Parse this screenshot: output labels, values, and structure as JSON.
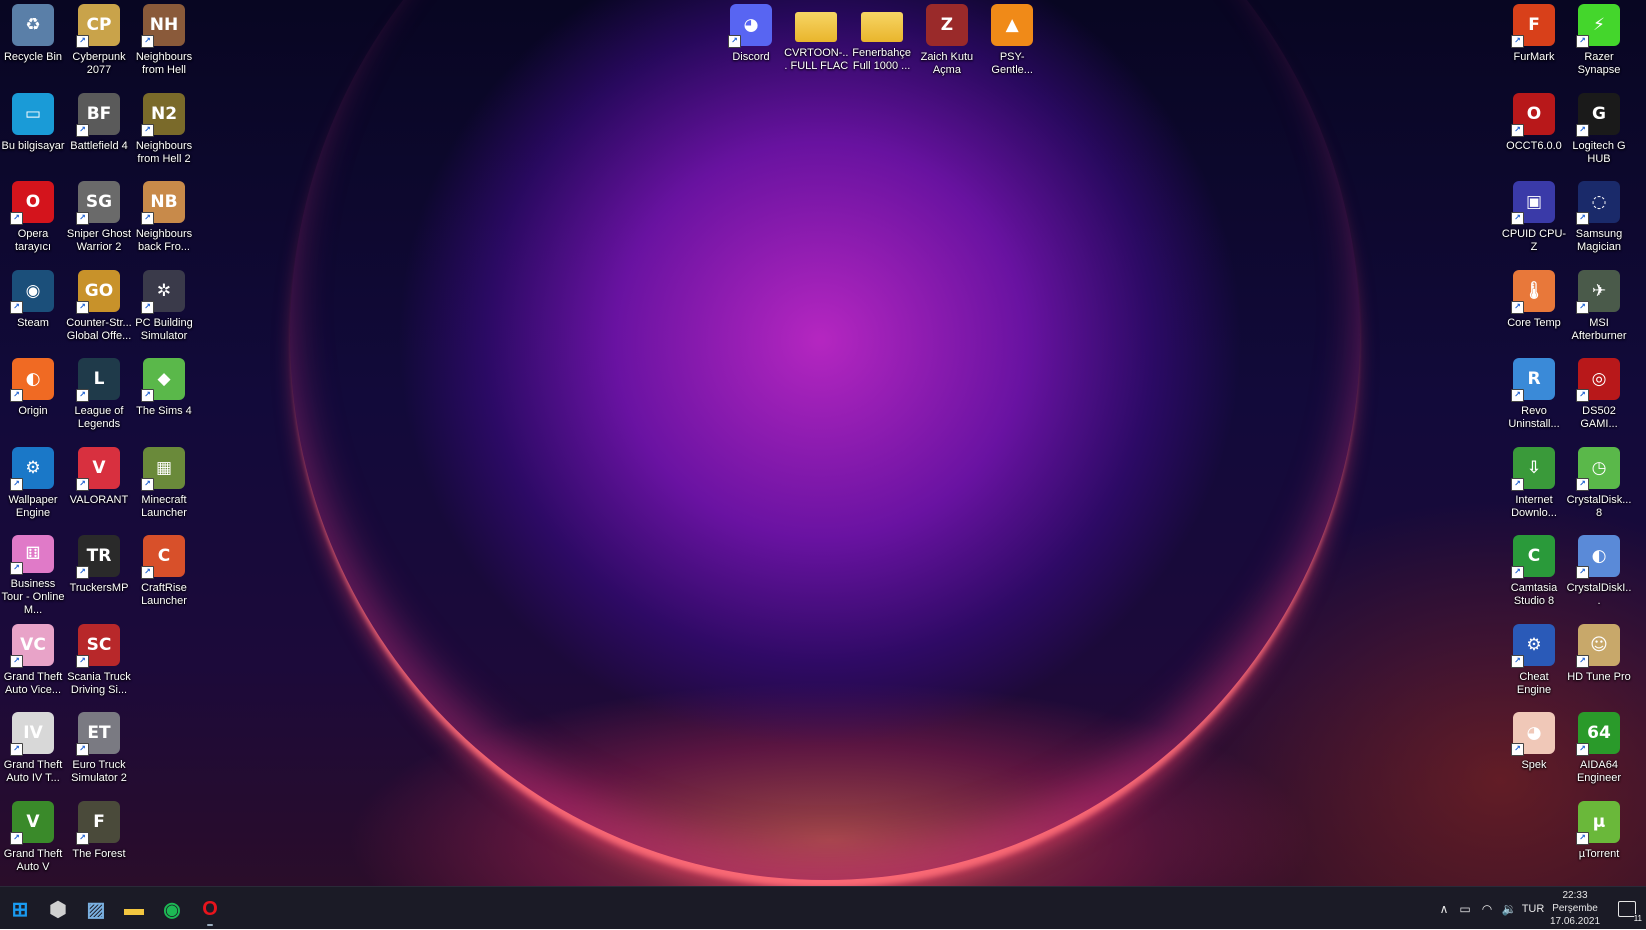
{
  "desktop_icons": {
    "col1": [
      {
        "label": "Recycle Bin",
        "icon": "recycle-bin-icon",
        "color": "#5a7fa8",
        "glyph": "♻",
        "shortcut": false
      },
      {
        "label": "Bu bilgisayar",
        "icon": "monitor-icon",
        "color": "#1a9bd7",
        "glyph": "▭",
        "shortcut": false
      },
      {
        "label": "Opera tarayıcı",
        "icon": "opera-icon",
        "color": "#d4141c",
        "glyph": "O",
        "shortcut": true
      },
      {
        "label": "Steam",
        "icon": "steam-icon",
        "color": "#1b4f7a",
        "glyph": "◉",
        "shortcut": true
      },
      {
        "label": "Origin",
        "icon": "origin-icon",
        "color": "#f06a23",
        "glyph": "◐",
        "shortcut": true
      },
      {
        "label": "Wallpaper Engine",
        "icon": "wallpaper-engine-icon",
        "color": "#1a78c8",
        "glyph": "⚙",
        "shortcut": true
      },
      {
        "label": "Business Tour - Online M...",
        "icon": "dice-icon",
        "color": "#e07ac8",
        "glyph": "⚅",
        "shortcut": true
      },
      {
        "label": "Grand Theft Auto Vice...",
        "icon": "gta-vice-city-icon",
        "color": "#e8a3c8",
        "glyph": "VC",
        "shortcut": true
      },
      {
        "label": "Grand Theft Auto IV T...",
        "icon": "gta-iv-icon",
        "color": "#d8d8d8",
        "glyph": "IV",
        "shortcut": true
      },
      {
        "label": "Grand Theft Auto V",
        "icon": "gta-v-icon",
        "color": "#3a8a2a",
        "glyph": "V",
        "shortcut": true
      }
    ],
    "col2": [
      {
        "label": "Cyberpunk 2077",
        "icon": "cyberpunk-icon",
        "color": "#c9a34a",
        "glyph": "CP",
        "shortcut": true
      },
      {
        "label": "Battlefield 4",
        "icon": "battlefield-icon",
        "color": "#5a5a5a",
        "glyph": "BF",
        "shortcut": true
      },
      {
        "label": "Sniper Ghost Warrior 2",
        "icon": "sniper-icon",
        "color": "#6a6a6a",
        "glyph": "SG",
        "shortcut": true
      },
      {
        "label": "Counter-Str... Global Offe...",
        "icon": "csgo-icon",
        "color": "#c8922a",
        "glyph": "GO",
        "shortcut": true
      },
      {
        "label": "League of Legends",
        "icon": "league-icon",
        "color": "#1f3a4a",
        "glyph": "L",
        "shortcut": true
      },
      {
        "label": "VALORANT",
        "icon": "valorant-icon",
        "color": "#d8303f",
        "glyph": "V",
        "shortcut": true
      },
      {
        "label": "TruckersMP",
        "icon": "truck-icon",
        "color": "#2a2a2a",
        "glyph": "TR",
        "shortcut": true
      },
      {
        "label": "Scania Truck Driving Si...",
        "icon": "scania-truck-icon",
        "color": "#b8282a",
        "glyph": "SC",
        "shortcut": true
      },
      {
        "label": "Euro Truck Simulator 2",
        "icon": "euro-truck-icon",
        "color": "#7a7a82",
        "glyph": "ET",
        "shortcut": true
      },
      {
        "label": "The Forest",
        "icon": "forest-icon",
        "color": "#4a4a3a",
        "glyph": "F",
        "shortcut": true
      }
    ],
    "col3": [
      {
        "label": "Neighbours from Hell",
        "icon": "neighbours-icon",
        "color": "#8a5a3a",
        "glyph": "NH",
        "shortcut": true
      },
      {
        "label": "Neighbours from Hell 2",
        "icon": "neighbours2-icon",
        "color": "#7a6a2a",
        "glyph": "N2",
        "shortcut": true
      },
      {
        "label": "Neighbours back Fro...",
        "icon": "neighbours-back-icon",
        "color": "#c88a4a",
        "glyph": "NB",
        "shortcut": true
      },
      {
        "label": "PC Building Simulator",
        "icon": "fan-icon",
        "color": "#3a3a4a",
        "glyph": "✲",
        "shortcut": true
      },
      {
        "label": "The Sims 4",
        "icon": "sims-icon",
        "color": "#5ab84a",
        "glyph": "◆",
        "shortcut": true
      },
      {
        "label": "Minecraft Launcher",
        "icon": "minecraft-icon",
        "color": "#6a8a3a",
        "glyph": "▦",
        "shortcut": true
      },
      {
        "label": "CraftRise Launcher",
        "icon": "craftrise-icon",
        "color": "#d8502a",
        "glyph": "C",
        "shortcut": true
      }
    ],
    "top": [
      {
        "label": "Discord",
        "icon": "discord-icon",
        "color": "#5865f2",
        "glyph": "◕",
        "shortcut": true
      },
      {
        "label": "CVRTOON-... FULL FLAC",
        "icon": "folder-icon",
        "color": "#f2c640",
        "glyph": "",
        "shortcut": false
      },
      {
        "label": "Fenerbahçe Full 1000 ...",
        "icon": "folder-icon",
        "color": "#f2c640",
        "glyph": "",
        "shortcut": false
      },
      {
        "label": "Zaich Kutu Açma",
        "icon": "zaich-icon",
        "color": "#9a2a2a",
        "glyph": "Z",
        "shortcut": false
      },
      {
        "label": "PSY-Gentle...",
        "icon": "vlc-icon",
        "color": "#f08a18",
        "glyph": "▲",
        "shortcut": false
      }
    ],
    "right1": [
      {
        "label": "FurMark",
        "icon": "furmark-icon",
        "color": "#d8401a",
        "glyph": "F",
        "shortcut": true
      },
      {
        "label": "OCCT6.0.0",
        "icon": "occt-icon",
        "color": "#b8181a",
        "glyph": "O",
        "shortcut": true
      },
      {
        "label": "CPUID CPU-Z",
        "icon": "cpu-icon",
        "color": "#3a3aa8",
        "glyph": "▣",
        "shortcut": true
      },
      {
        "label": "Core Temp",
        "icon": "thermometer-icon",
        "color": "#e8783a",
        "glyph": "🌡",
        "shortcut": true
      },
      {
        "label": "Revo Uninstall...",
        "icon": "revo-icon",
        "color": "#3a8ad8",
        "glyph": "R",
        "shortcut": true
      },
      {
        "label": "Internet Downlo...",
        "icon": "idm-icon",
        "color": "#3a9a3a",
        "glyph": "⇩",
        "shortcut": true
      },
      {
        "label": "Camtasia Studio 8",
        "icon": "camtasia-icon",
        "color": "#2a9a3a",
        "glyph": "C",
        "shortcut": true
      },
      {
        "label": "Cheat Engine",
        "icon": "cheat-engine-icon",
        "color": "#2a5ab8",
        "glyph": "⚙",
        "shortcut": true
      },
      {
        "label": "Spek",
        "icon": "spek-icon",
        "color": "#f0c8b8",
        "glyph": "◕",
        "shortcut": true
      }
    ],
    "right2": [
      {
        "label": "Razer Synapse",
        "icon": "razer-icon",
        "color": "#44d62c",
        "glyph": "⚡",
        "shortcut": true
      },
      {
        "label": "Logitech G HUB",
        "icon": "logitech-icon",
        "color": "#1a1a1a",
        "glyph": "G",
        "shortcut": true
      },
      {
        "label": "Samsung Magician",
        "icon": "samsung-magician-icon",
        "color": "#1a2a6a",
        "glyph": "◌",
        "shortcut": true
      },
      {
        "label": "MSI Afterburner",
        "icon": "msi-icon",
        "color": "#4a5a4a",
        "glyph": "✈",
        "shortcut": true
      },
      {
        "label": "DS502 GAMI...",
        "icon": "headset-icon",
        "color": "#b8181a",
        "glyph": "◎",
        "shortcut": true
      },
      {
        "label": "CrystalDisk... 8",
        "icon": "crystaldisk-icon",
        "color": "#5ab84a",
        "glyph": "◷",
        "shortcut": true
      },
      {
        "label": "CrystalDiskI...",
        "icon": "crystaldiskinfo-icon",
        "color": "#5a8ad8",
        "glyph": "◐",
        "shortcut": true
      },
      {
        "label": "HD Tune Pro",
        "icon": "hdtune-icon",
        "color": "#c8a86a",
        "glyph": "☺",
        "shortcut": true
      },
      {
        "label": "AIDA64 Engineer",
        "icon": "aida64-icon",
        "color": "#2a9a2a",
        "glyph": "64",
        "shortcut": true
      },
      {
        "label": "µTorrent",
        "icon": "utorrent-icon",
        "color": "#6ab83a",
        "glyph": "µ",
        "shortcut": true
      }
    ]
  },
  "taskbar": {
    "apps": [
      {
        "name": "start-button",
        "icon": "windows-icon",
        "glyph": "⊞",
        "color": "#1a9bf0"
      },
      {
        "name": "taskbar-app-hex",
        "icon": "hexagon-icon",
        "glyph": "⬢",
        "color": "#d0d0d0"
      },
      {
        "name": "taskbar-app-photos",
        "icon": "photos-icon",
        "glyph": "▨",
        "color": "#7ab0e0"
      },
      {
        "name": "taskbar-app-explorer",
        "icon": "folder-icon",
        "glyph": "▬",
        "color": "#f2c640"
      },
      {
        "name": "taskbar-app-spotify",
        "icon": "spotify-icon",
        "glyph": "◉",
        "color": "#1db954"
      },
      {
        "name": "taskbar-app-opera",
        "icon": "opera-icon",
        "glyph": "O",
        "color": "#e8141c"
      }
    ],
    "tray": {
      "language": "TUR",
      "time": "22:33",
      "day": "Perşembe",
      "date": "17.06.2021",
      "notifications_count": "11"
    }
  },
  "colors": {
    "taskbar_bg": "#1b1b26",
    "label_text": "#ffffff"
  }
}
